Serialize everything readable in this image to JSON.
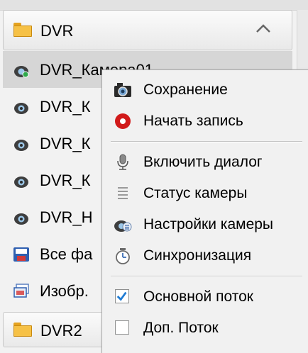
{
  "group": {
    "label": "DVR"
  },
  "tree_items": [
    {
      "label": "DVR_Камера01"
    },
    {
      "label": "DVR_К"
    },
    {
      "label": "DVR_К"
    },
    {
      "label": "DVR_К"
    },
    {
      "label": "DVR_Н"
    },
    {
      "label": "Все фа"
    },
    {
      "label": "Изобр."
    }
  ],
  "group2": {
    "label": "DVR2"
  },
  "menu": {
    "items": [
      {
        "label": "Сохранение",
        "icon": "camera-icon"
      },
      {
        "label": "Начать запись",
        "icon": "record-icon"
      },
      {
        "label": "Включить диалог",
        "icon": "microphone-icon"
      },
      {
        "label": "Статус камеры",
        "icon": "status-list-icon"
      },
      {
        "label": "Настройки камеры",
        "icon": "camera-settings-icon"
      },
      {
        "label": "Синхронизация",
        "icon": "clock-sync-icon"
      },
      {
        "label": "Основной поток",
        "checked": true
      },
      {
        "label": "Доп. Поток",
        "checked": false
      }
    ]
  },
  "colors": {
    "accent": "#1e7bd3",
    "record": "#d11a1a",
    "folder": "#f6c146"
  }
}
